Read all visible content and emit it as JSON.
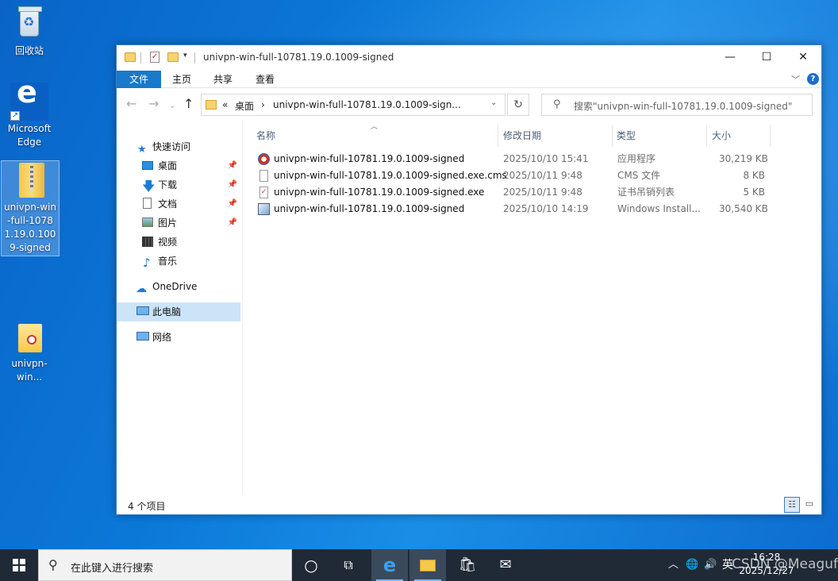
{
  "desktop": {
    "icons": [
      {
        "label": "回收站"
      },
      {
        "label": "Microsoft Edge"
      },
      {
        "label": "univpn-win-full-10781.19.0.1009-signed"
      },
      {
        "label": "univpn-win..."
      }
    ]
  },
  "window": {
    "title": "univpn-win-full-10781.19.0.1009-signed",
    "controls": {
      "minimize": "—",
      "maximize": "☐",
      "close": "✕"
    },
    "ribbon_tabs": [
      "文件",
      "主页",
      "共享",
      "查看"
    ],
    "address": {
      "chevron": "«",
      "segment1": "桌面",
      "sep": "›",
      "segment2": "univpn-win-full-10781.19.0.1009-sign..."
    },
    "search_placeholder": "搜索\"univpn-win-full-10781.19.0.1009-signed\"",
    "nav_items": [
      {
        "label": "快速访问",
        "pinned": false
      },
      {
        "label": "桌面",
        "pinned": true
      },
      {
        "label": "下载",
        "pinned": true
      },
      {
        "label": "文档",
        "pinned": true
      },
      {
        "label": "图片",
        "pinned": true
      },
      {
        "label": "视频",
        "pinned": false
      },
      {
        "label": "音乐",
        "pinned": false
      },
      {
        "label": "OneDrive",
        "pinned": false
      },
      {
        "label": "此电脑",
        "pinned": false,
        "selected": true
      },
      {
        "label": "网络",
        "pinned": false
      }
    ],
    "columns": [
      "名称",
      "修改日期",
      "类型",
      "大小"
    ],
    "files": [
      {
        "name": "univpn-win-full-10781.19.0.1009-signed",
        "date": "2025/10/10 15:41",
        "type": "应用程序",
        "size": "30,219 KB",
        "icon": "app-icon"
      },
      {
        "name": "univpn-win-full-10781.19.0.1009-signed.exe.cms",
        "date": "2025/10/11 9:48",
        "type": "CMS 文件",
        "size": "8 KB",
        "icon": "blank-file-icon"
      },
      {
        "name": "univpn-win-full-10781.19.0.1009-signed.exe",
        "date": "2025/10/11 9:48",
        "type": "证书吊销列表",
        "size": "5 KB",
        "icon": "certificate-icon"
      },
      {
        "name": "univpn-win-full-10781.19.0.1009-signed",
        "date": "2025/10/10 14:19",
        "type": "Windows Install...",
        "size": "30,540 KB",
        "icon": "installer-icon"
      }
    ],
    "status": "4 个项目"
  },
  "taskbar": {
    "search_placeholder": "在此键入进行搜索",
    "ime": "英",
    "time": "16:28",
    "date": "2025/12/27"
  },
  "watermark": "CSDN @Meaguf",
  "colors": {
    "accent": "#1979ca",
    "selection": "#cce4f7",
    "taskbar": "#1f2a36"
  }
}
